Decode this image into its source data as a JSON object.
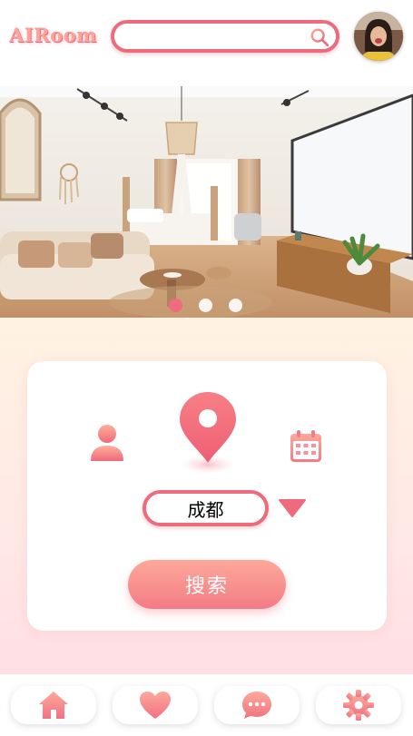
{
  "header": {
    "logo_text": "AIRoom",
    "search": {
      "value": "",
      "placeholder": ""
    }
  },
  "avatar": {
    "name": "user-avatar"
  },
  "carousel": {
    "slide_count": 3,
    "active_index": 0
  },
  "search_card": {
    "person_icon": "person-icon",
    "location_icon": "location-pin-icon",
    "calendar_icon": "calendar-icon",
    "city_value": "成都",
    "dropdown_icon": "triangle-down-icon",
    "search_button_label": "搜索"
  },
  "bottom_nav": {
    "items": [
      {
        "name": "home",
        "icon": "home-icon"
      },
      {
        "name": "favorites",
        "icon": "heart-icon"
      },
      {
        "name": "messages",
        "icon": "chat-icon"
      },
      {
        "name": "settings",
        "icon": "gear-icon"
      }
    ]
  },
  "colors": {
    "accent": "#ec6b7c",
    "gradient_start": "#fda99a",
    "gradient_end": "#f37b85",
    "background_top": "#fff2e2",
    "background_bottom": "#ffdfe4"
  }
}
